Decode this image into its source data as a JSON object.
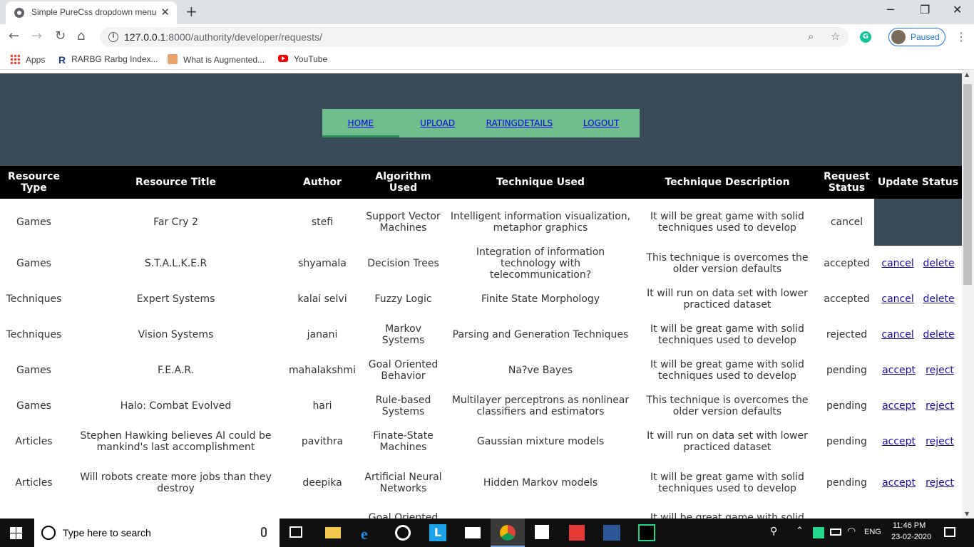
{
  "browser": {
    "tab_title": "Simple PureCss dropdown menu",
    "tab_close": "✕",
    "new_tab": "+",
    "url_host": "127.0.0.1",
    "url_path": ":8000/authority/developer/requests/",
    "profile_label": "Paused",
    "bookmarks": [
      "Apps",
      "RARBG Rarbg Index...",
      "What is Augmented...",
      "YouTube"
    ]
  },
  "nav": {
    "items": [
      "HOME",
      "UPLOAD",
      "RATINGDETAILS",
      "LOGOUT"
    ]
  },
  "table": {
    "headers": [
      "Resource Type",
      "Resource Title",
      "Author",
      "Algorithm Used",
      "Technique Used",
      "Technique Description",
      "Request Status",
      "Update Status"
    ],
    "rows": [
      {
        "type": "Games",
        "title": "Far Cry 2",
        "author": "stefi",
        "algorithm": "Support Vector Machines",
        "technique": "Intelligent information visualization, metaphor graphics",
        "description": "It will be great game with solid techniques used to develop",
        "status": "cancel",
        "action1": "",
        "action2": ""
      },
      {
        "type": "Games",
        "title": "S.T.A.L.K.E.R",
        "author": "shyamala",
        "algorithm": "Decision Trees",
        "technique": "Integration of information technology with telecommunication?",
        "description": "This technique is overcomes the older version defaults",
        "status": "accepted",
        "action1": "cancel",
        "action2": "delete"
      },
      {
        "type": "Techniques",
        "title": "Expert Systems",
        "author": "kalai selvi",
        "algorithm": "Fuzzy Logic",
        "technique": "Finite State Morphology",
        "description": "It will run on data set with lower practiced dataset",
        "status": "accepted",
        "action1": "cancel",
        "action2": "delete"
      },
      {
        "type": "Techniques",
        "title": "Vision Systems",
        "author": "janani",
        "algorithm": "Markov Systems",
        "technique": "Parsing and Generation Techniques",
        "description": "It will be great game with solid techniques used to develop",
        "status": "rejected",
        "action1": "cancel",
        "action2": "delete"
      },
      {
        "type": "Games",
        "title": "F.E.A.R.",
        "author": "mahalakshmi",
        "algorithm": "Goal Oriented Behavior",
        "technique": "Na?ve Bayes",
        "description": "It will be great game with solid techniques used to develop",
        "status": "pending",
        "action1": "accept",
        "action2": "reject"
      },
      {
        "type": "Games",
        "title": "Halo: Combat Evolved",
        "author": "hari",
        "algorithm": "Rule-based Systems",
        "technique": "Multilayer perceptrons as nonlinear classifiers and estimators",
        "description": "This technique is overcomes the older version defaults",
        "status": "pending",
        "action1": "accept",
        "action2": "reject"
      },
      {
        "type": "Articles",
        "title": "Stephen Hawking believes AI could be mankind's last accomplishment",
        "author": "pavithra",
        "algorithm": "Finate-State Machines",
        "technique": "Gaussian mixture models",
        "description": "It will run on data set with lower practiced dataset",
        "status": "pending",
        "action1": "accept",
        "action2": "reject"
      },
      {
        "type": "Articles",
        "title": "Will robots create more jobs than they destroy",
        "author": "deepika",
        "algorithm": "Artificial Neural Networks",
        "technique": "Hidden Markov models",
        "description": "It will be great game with solid techniques used to develop",
        "status": "pending",
        "action1": "accept",
        "action2": "reject"
      },
      {
        "type": "",
        "title": "",
        "author": "",
        "algorithm": "Goal Oriented",
        "technique": "",
        "description": "It will be great game with solid",
        "status": "",
        "action1": "",
        "action2": ""
      }
    ]
  },
  "taskbar": {
    "search_placeholder": "Type here to search",
    "language": "ENG",
    "time": "11:46 PM",
    "date": "23-02-2020"
  },
  "colors": {
    "header_band": "#394a59",
    "menu_bg": "#6fbe8c",
    "table_header": "#000000",
    "taskbar": "#101010"
  }
}
